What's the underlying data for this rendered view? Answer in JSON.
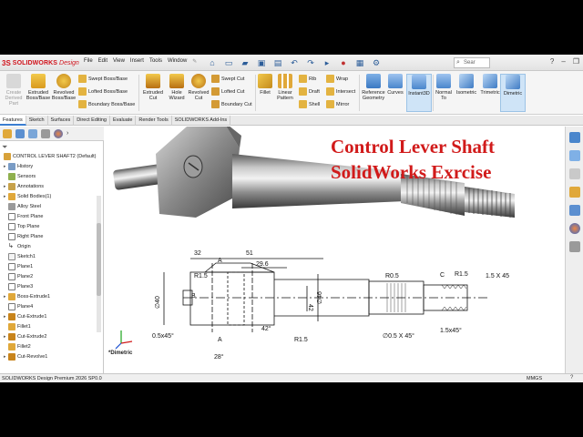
{
  "app": {
    "logo_ds": "3S",
    "logo_brand": "SOLIDWORKS",
    "logo_edition": "Design"
  },
  "menu": [
    "File",
    "Edit",
    "View",
    "Insert",
    "Tools",
    "Window"
  ],
  "search": {
    "placeholder": "Sear"
  },
  "commands": {
    "create_derived": "Create Derived Part",
    "extruded_boss": "Extruded Boss/Base",
    "revolved_boss": "Revolved Boss/Base",
    "swept_boss": "Swept Boss/Base",
    "lofted_boss": "Lofted Boss/Base",
    "boundary_boss": "Boundary Boss/Base",
    "extruded_cut": "Extruded Cut",
    "hole_wizard": "Hole Wizard",
    "revolved_cut": "Revolved Cut",
    "swept_cut": "Swept Cut",
    "lofted_cut": "Lofted Cut",
    "boundary_cut": "Boundary Cut",
    "fillet": "Fillet",
    "linear_pattern": "Linear Pattern",
    "rib": "Rib",
    "draft": "Draft",
    "shell": "Shell",
    "wrap": "Wrap",
    "intersect": "Intersect",
    "mirror": "Mirror",
    "reference_geometry": "Reference Geometry",
    "curves": "Curves",
    "instant3d": "Instant3D",
    "normal_to": "Normal To",
    "isometric": "Isometric",
    "trimetric": "Trimetric",
    "dimetric": "Dimetric"
  },
  "tabs": [
    "Features",
    "Sketch",
    "Surfaces",
    "Direct Editing",
    "Evaluate",
    "Render Tools",
    "SOLIDWORKS Add-Ins"
  ],
  "tree": {
    "root": "CONTROL LEVER SHAFT2  (Default)",
    "items": [
      "History",
      "Sensors",
      "Annotations",
      "Solid Bodies(1)",
      "Alloy Steel",
      "Front Plane",
      "Top Plane",
      "Right Plane",
      "Origin",
      "Sketch1",
      "Plane1",
      "Plane2",
      "Plane3",
      "Boss-Extrude1",
      "Plane4",
      "Cut-Extrude1",
      "Fillet1",
      "Cut-Extrude2",
      "Fillet2",
      "Cut-Revolve1"
    ]
  },
  "viewport": {
    "title_line1": "Control Lever Shaft",
    "title_line2": "SolidWorks Exrcise",
    "view_label": "*Dimetric"
  },
  "drawing": {
    "dims": [
      "32",
      "51",
      "29.6",
      "A",
      "A",
      "R1.5",
      "∅46",
      "∅40",
      "B",
      "0.5x45°",
      "R1.5",
      "42°",
      "28°",
      "42",
      "R0.5",
      "C",
      "R1.5",
      "1.5 X 45",
      "∅0.5 X 45°",
      "1.5x45°"
    ]
  },
  "status": {
    "left": "SOLIDWORKS Design Premium 2026 SP0.0",
    "units": "MMGS",
    "help": "?"
  },
  "colors": {
    "accent_red": "#d11a1a",
    "toolbar_bg": "#f5f5f5",
    "selection": "#cfe4f7"
  }
}
